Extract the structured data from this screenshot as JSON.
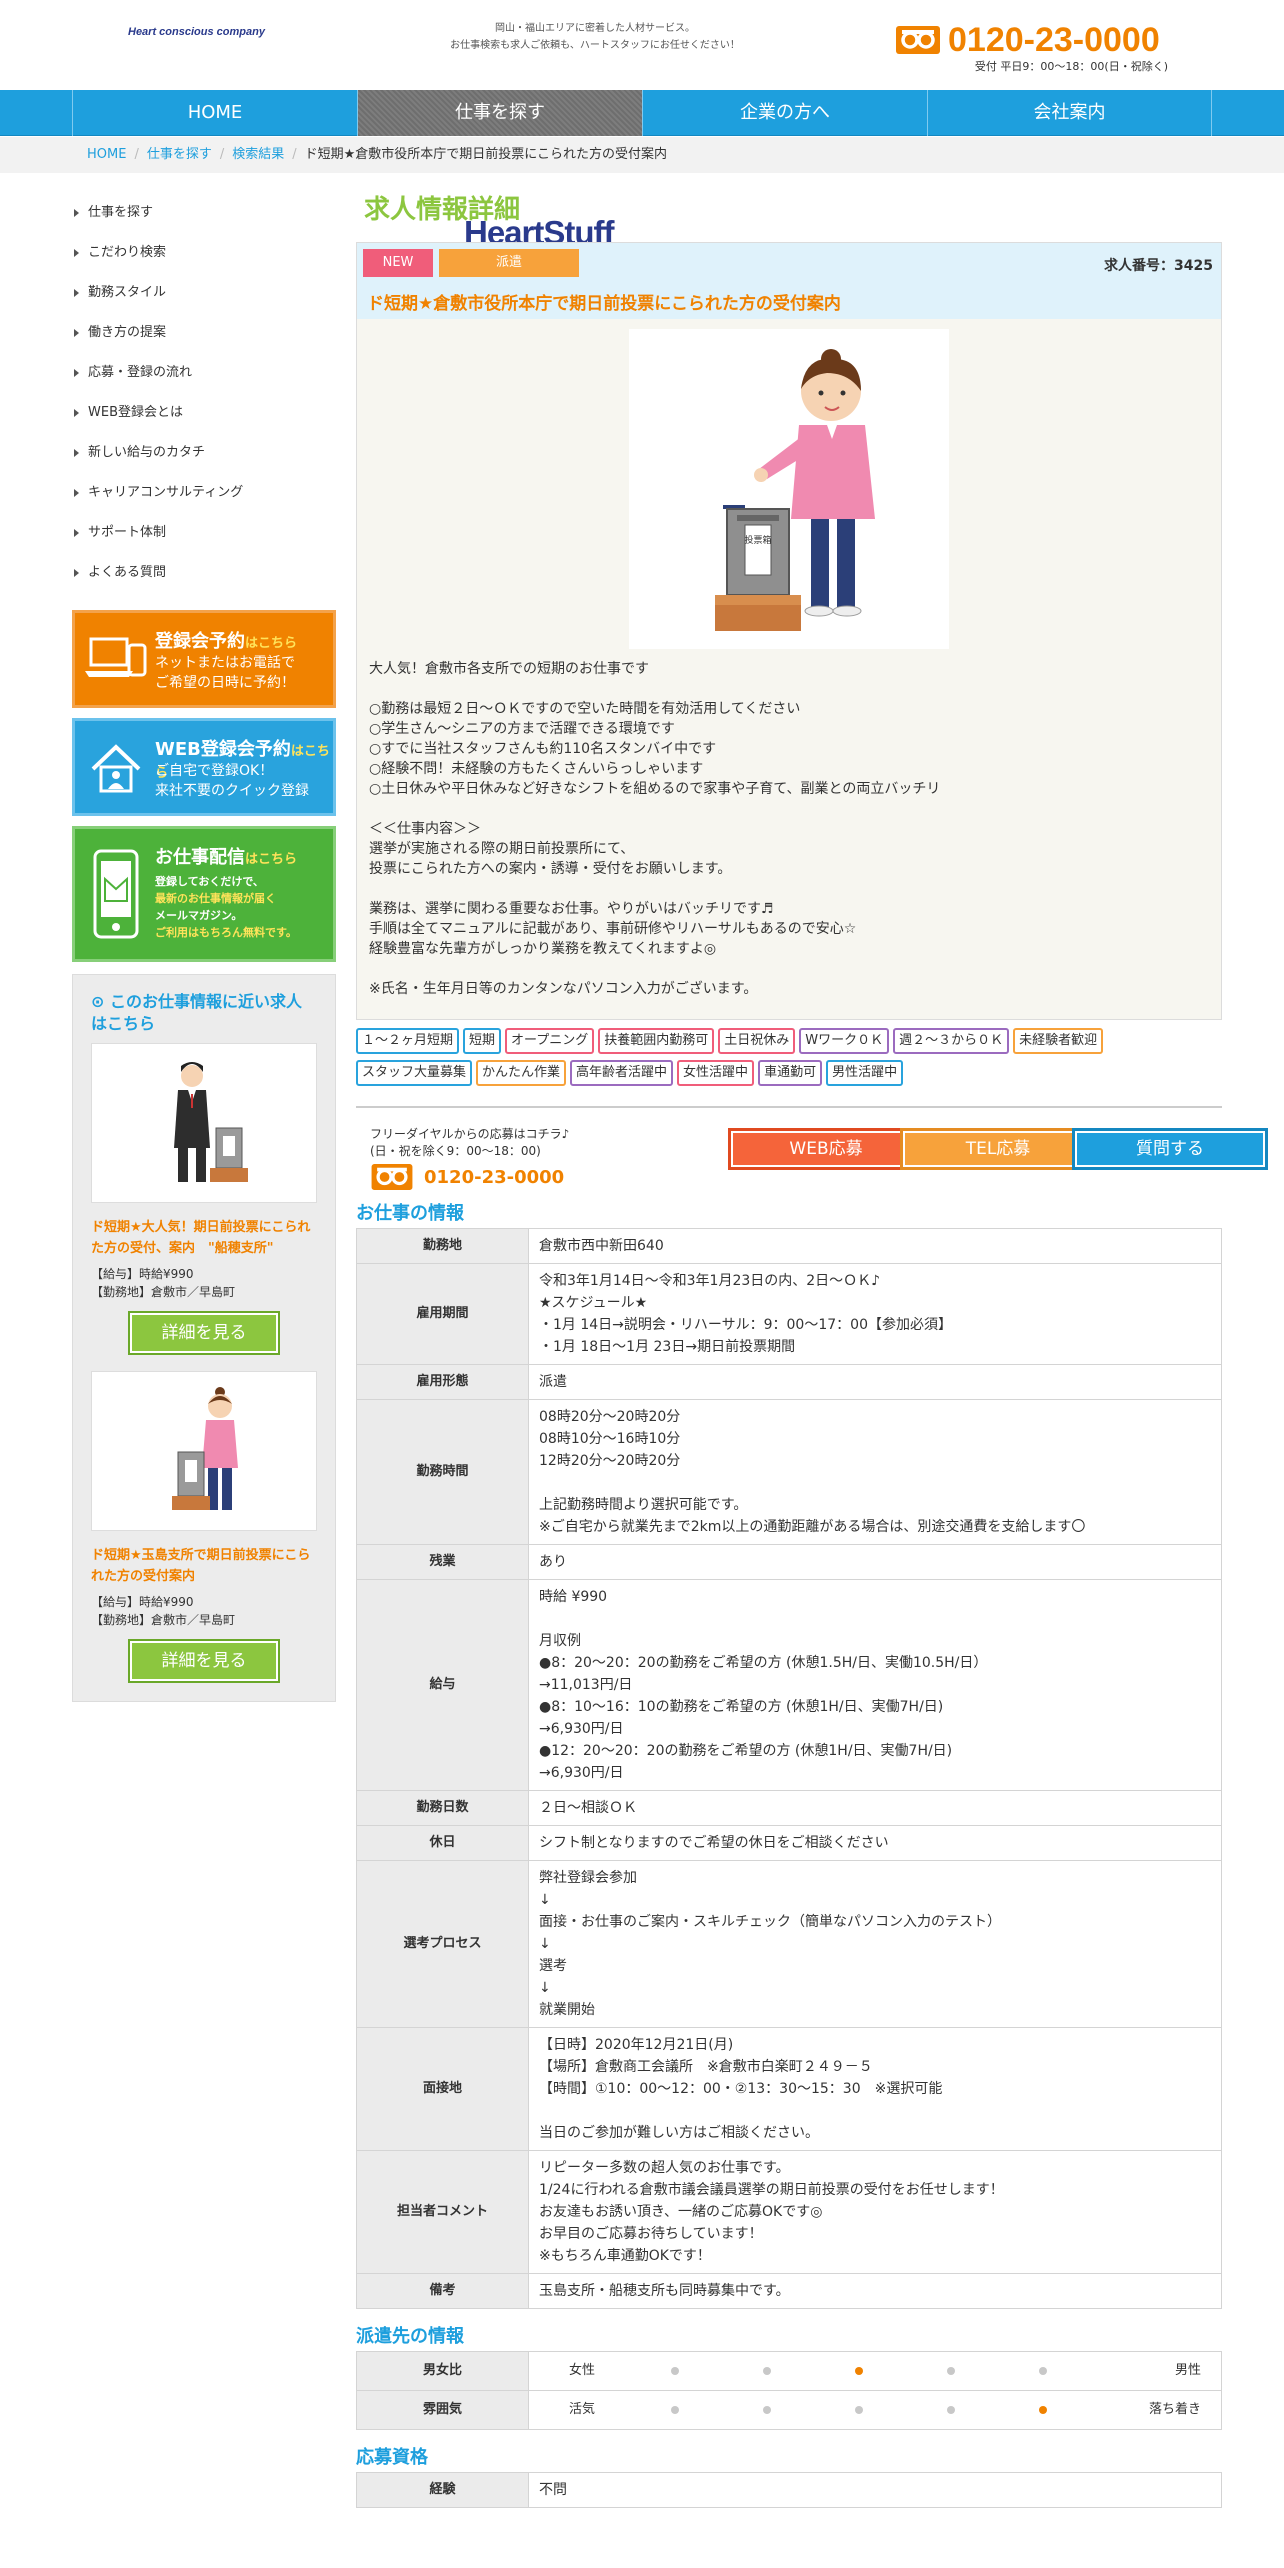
{
  "header": {
    "logo_main": "HeartStuff",
    "logo_sub": "Heart conscious company",
    "tagline_1": "岡山・福山エリアに密着した人材サービス。",
    "tagline_2": "お仕事検索も求人ご依頼も、ハートスタッフにお任せください！",
    "phone": "0120-23-0000",
    "hours": "受付 平日9：00～18：00(日・祝除く)"
  },
  "nav": [
    "HOME",
    "仕事を探す",
    "企業の方へ",
    "会社案内"
  ],
  "breadcrumb": [
    "HOME",
    "仕事を探す",
    "検索結果",
    "ド短期★倉敷市役所本庁で期日前投票にこられた方の受付案内"
  ],
  "sidebar": {
    "menu": [
      "仕事を探す",
      "こだわり検索",
      "勤務スタイル",
      "働き方の提案",
      "応募・登録の流れ",
      "WEB登録会とは",
      "新しい給与のカタチ",
      "キャリアコンサルティング",
      "サポート体制",
      "よくある質問"
    ],
    "banner1": {
      "title": "登録会予約",
      "title_suffix": "はこちら",
      "line1": "ネットまたはお電話で",
      "line2": "ご希望の日時に予約！"
    },
    "banner2": {
      "title": "WEB登録会予約",
      "title_suffix": "はこちら",
      "line1": "ご自宅で登録OK！",
      "line2": "来社不要のクイック登録"
    },
    "banner3": {
      "title": "お仕事配信",
      "title_suffix": "はこちら",
      "line1": "登録しておくだけで、",
      "line2": "最新のお仕事情報が届く",
      "line3": "メールマガジン。",
      "line4": "ご利用はもちろん無料です。"
    },
    "near_heading": "このお仕事情報に近い求人はこちら",
    "cards": [
      {
        "title": "ド短期★大人気！期日前投票にこられた方の受付、案内　\"船穂支所\"",
        "salary": "【給与】時給¥990",
        "place": "【勤務地】倉敷市／早島町",
        "button": "詳細を見る"
      },
      {
        "title": "ド短期★玉島支所で期日前投票にこられた方の受付案内",
        "salary": "【給与】時給¥990",
        "place": "【勤務地】倉敷市／早島町",
        "button": "詳細を見る"
      }
    ]
  },
  "main": {
    "heading": "求人情報詳細",
    "badge_new": "NEW",
    "badge_type": "派遣",
    "job_no": "求人番号：3425",
    "job_title": "ド短期★倉敷市役所本庁で期日前投票にこられた方の受付案内",
    "ballot_label": "投票箱",
    "description": "大人気！倉敷市各支所での短期のお仕事です\n\n○勤務は最短２日～ＯＫですので空いた時間を有効活用してください\n○学生さん～シニアの方まで活躍できる環境です\n○すでに当社スタッフさんも約110名スタンバイ中です\n○経験不問！未経験の方もたくさんいらっしゃいます\n○土日休みや平日休みなど好きなシフトを組めるので家事や子育て、副業との両立バッチリ\n\n＜＜仕事内容＞＞\n選挙が実施される際の期日前投票所にて、\n投票にこられた方への案内・誘導・受付をお願いします。\n\n業務は、選挙に関わる重要なお仕事。やりがいはバッチリです♬\n手順は全てマニュアルに記載があり、事前研修やリハーサルもあるので安心☆\n経験豊富な先輩方がしっかり業務を教えてくれますよ◎\n\n※氏名・生年月日等のカンタンなパソコン入力がございます。",
    "tags": [
      {
        "label": "１～２ヶ月短期",
        "color": "#29a3dd"
      },
      {
        "label": "短期",
        "color": "#29a3dd"
      },
      {
        "label": "オープニング",
        "color": "#f05d7a"
      },
      {
        "label": "扶養範囲内勤務可",
        "color": "#f05d7a"
      },
      {
        "label": "土日祝休み",
        "color": "#f05d7a"
      },
      {
        "label": "Wワーク０Ｋ",
        "color": "#9b6bbf"
      },
      {
        "label": "週２～３から０Ｋ",
        "color": "#9b6bbf"
      },
      {
        "label": "未経験者歓迎",
        "color": "#f7a23b"
      },
      {
        "label": "スタッフ大量募集",
        "color": "#29a3dd"
      },
      {
        "label": "かんたん作業",
        "color": "#f7a23b"
      },
      {
        "label": "高年齢者活躍中",
        "color": "#9b6bbf"
      },
      {
        "label": "女性活躍中",
        "color": "#f05d7a"
      },
      {
        "label": "車通勤可",
        "color": "#9b6bbf"
      },
      {
        "label": "男性活躍中",
        "color": "#29a3dd"
      }
    ],
    "apply_text_1": "フリーダイヤルからの応募はコチラ♪",
    "apply_text_2": "(日・祝を除く9：00～18：00)",
    "apply_phone": "0120-23-0000",
    "btn_web": "WEB応募",
    "btn_tel": "TEL応募",
    "btn_q": "質問する",
    "section_job": "お仕事の情報",
    "job_rows": [
      {
        "k": "勤務地",
        "v": "倉敷市西中新田640"
      },
      {
        "k": "雇用期間",
        "v": "令和3年1月14日～令和3年1月23日の内、2日～ＯＫ♪\n★スケジュール★\n・1月 14日→説明会・リハーサル：9：00～17：00【参加必須】\n・1月 18日～1月 23日→期日前投票期間"
      },
      {
        "k": "雇用形態",
        "v": "派遣"
      },
      {
        "k": "勤務時間",
        "v": "08時20分〜20時20分\n08時10分〜16時10分\n12時20分〜20時20分\n\n上記勤務時間より選択可能です。\n※ご自宅から就業先まで2km以上の通勤距離がある場合は、別途交通費を支給します〇"
      },
      {
        "k": "残業",
        "v": "あり"
      },
      {
        "k": "給与",
        "v": "時給 ¥990\n\n月収例\n●8：20～20：20の勤務をご希望の方 (休憩1.5H/日、実働10.5H/日）\n→11,013円/日\n●8：10～16：10の勤務をご希望の方 (休憩1H/日、実働7H/日)\n→6,930円/日\n●12：20～20：20の勤務をご希望の方 (休憩1H/日、実働7H/日)\n→6,930円/日"
      },
      {
        "k": "勤務日数",
        "v": "２日～相談ＯＫ"
      },
      {
        "k": "休日",
        "v": "シフト制となりますのでご希望の休日をご相談ください"
      },
      {
        "k": "選考プロセス",
        "v": "弊社登録会参加\n↓\n面接・お仕事のご案内・スキルチェック（簡単なパソコン入力のテスト）\n↓\n選考\n↓\n就業開始"
      },
      {
        "k": "面接地",
        "v": "【日時】2020年12月21日(月)\n【場所】倉敷商工会議所　※倉敷市白楽町２４９－５\n【時間】①10：00～12：00・②13：30～15：30　※選択可能\n\n当日のご参加が難しい方はご相談ください。"
      },
      {
        "k": "担当者コメント",
        "v": "リピーター多数の超人気のお仕事です。\n1/24に行われる倉敷市議会議員選挙の期日前投票の受付をお任せします！\nお友達もお誘い頂き、一緒のご応募OKです◎\nお早目のご応募お待ちしています！\n※もちろん車通勤OKです！"
      },
      {
        "k": "備考",
        "v": "玉島支所・船穂支所も同時募集中です。"
      }
    ],
    "section_dest": "派遣先の情報",
    "dest_rows": [
      {
        "k": "男女比",
        "left": "女性",
        "right": "男性",
        "level": 3
      },
      {
        "k": "雰囲気",
        "left": "活気",
        "right": "落ち着き",
        "level": 5
      }
    ],
    "section_req": "応募資格",
    "req_rows": [
      {
        "k": "経験",
        "v": "不問"
      }
    ]
  }
}
